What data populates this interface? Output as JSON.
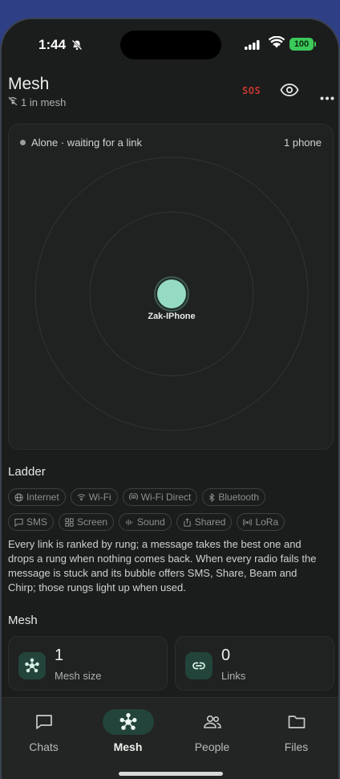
{
  "status_bar": {
    "time": "1:44",
    "battery": "100"
  },
  "header": {
    "title": "Mesh",
    "subtitle": "1 in mesh",
    "sos_label": "SOS"
  },
  "mesh_card": {
    "status": "Alone · waiting for a link",
    "count": "1 phone",
    "node_label": "Zak-IPhone"
  },
  "ladder": {
    "heading": "Ladder",
    "chips_row1": [
      {
        "label": "Internet",
        "icon": "globe-icon"
      },
      {
        "label": "Wi-Fi",
        "icon": "wifi-icon"
      },
      {
        "label": "Wi-Fi Direct",
        "icon": "wifi-direct-icon"
      },
      {
        "label": "Bluetooth",
        "icon": "bluetooth-icon"
      }
    ],
    "chips_row2": [
      {
        "label": "SMS",
        "icon": "sms-icon"
      },
      {
        "label": "Screen",
        "icon": "screen-icon"
      },
      {
        "label": "Sound",
        "icon": "sound-icon"
      },
      {
        "label": "Shared",
        "icon": "share-icon"
      },
      {
        "label": "LoRa",
        "icon": "lora-icon"
      }
    ],
    "description": "Every link is ranked by rung; a message takes the best one and drops a rung when nothing comes back. When every radio fails the message is stuck and its bubble offers SMS, Share, Beam and Chirp; those rungs light up when used."
  },
  "mesh_section": {
    "heading": "Mesh",
    "stats": [
      {
        "value": "1",
        "label": "Mesh size",
        "icon": "mesh-icon"
      },
      {
        "value": "0",
        "label": "Links",
        "icon": "link-icon"
      }
    ]
  },
  "nav": {
    "items": [
      {
        "label": "Chats",
        "icon": "chat-icon",
        "active": false
      },
      {
        "label": "Mesh",
        "icon": "mesh-icon",
        "active": true
      },
      {
        "label": "People",
        "icon": "people-icon",
        "active": false
      },
      {
        "label": "Files",
        "icon": "folder-icon",
        "active": false
      }
    ]
  },
  "colors": {
    "accent": "#95dbc3",
    "accent_bg": "#22443a",
    "sos": "#c4392f",
    "battery": "#3bc95a"
  }
}
